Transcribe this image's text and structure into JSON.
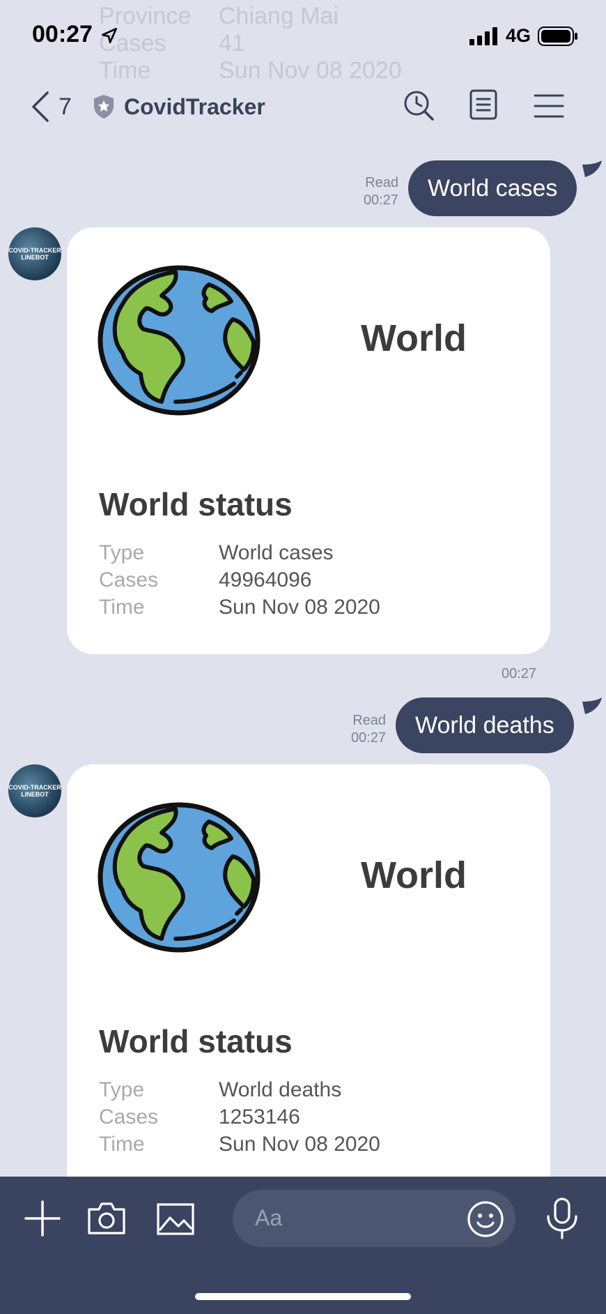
{
  "status_bar": {
    "time": "00:27",
    "network": "4G"
  },
  "scrolled_ghost": {
    "rows": [
      {
        "key": "Province",
        "value": "Chiang Mai"
      },
      {
        "key": "Cases",
        "value": "41"
      },
      {
        "key": "Time",
        "value": "Sun Nov 08 2020"
      }
    ]
  },
  "header": {
    "back_count": "7",
    "title": "CovidTracker",
    "icons": [
      "back-chevron-icon",
      "shield-icon",
      "search-clock-icon",
      "notes-icon",
      "menu-icon"
    ]
  },
  "messages": [
    {
      "outgoing": {
        "text": "World cases",
        "read_label": "Read",
        "time": "00:27"
      },
      "card": {
        "avatar_text": "COVID-TRACKER LINEBOT",
        "heading": "World",
        "status_title": "World status",
        "rows": [
          {
            "key": "Type",
            "value": "World cases"
          },
          {
            "key": "Cases",
            "value": "49964096"
          },
          {
            "key": "Time",
            "value": "Sun Nov 08 2020"
          }
        ],
        "time": "00:27"
      }
    },
    {
      "outgoing": {
        "text": "World deaths",
        "read_label": "Read",
        "time": "00:27"
      },
      "card": {
        "avatar_text": "COVID-TRACKER LINEBOT",
        "heading": "World",
        "status_title": "World status",
        "rows": [
          {
            "key": "Type",
            "value": "World deaths"
          },
          {
            "key": "Cases",
            "value": "1253146"
          },
          {
            "key": "Time",
            "value": "Sun Nov 08 2020"
          }
        ]
      }
    }
  ],
  "composer": {
    "placeholder": "Aa"
  },
  "colors": {
    "background": "#dfe2ec",
    "bubble": "#3b4562",
    "bar": "#3a4460",
    "globe_ocean": "#5fa3dc",
    "globe_land": "#8bc34a"
  }
}
